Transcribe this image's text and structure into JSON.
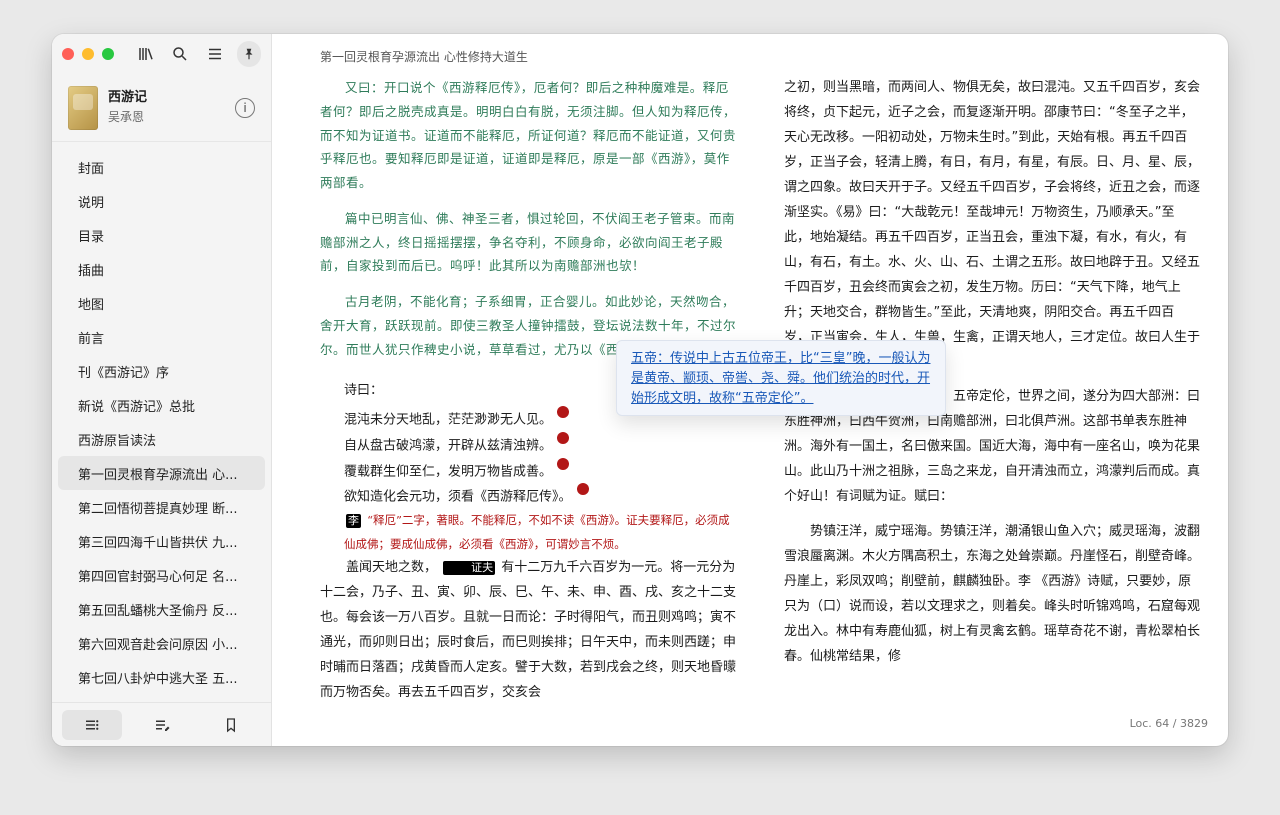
{
  "sidebar": {
    "toolbar": {
      "library_icon": "library-icon",
      "search_icon": "search-icon",
      "list_icon": "list-icon",
      "pin_icon": "pin-icon"
    },
    "book": {
      "title": "西游记",
      "author": "吴承恩",
      "info_icon": "info-icon"
    },
    "toc": [
      "封面",
      "说明",
      "目录",
      "插曲",
      "地图",
      "前言",
      "刊《西游记》序",
      "新说《西游记》总批",
      "西游原旨读法",
      "第一回灵根育孕源流出 心...",
      "第二回悟彻菩提真妙理 断...",
      "第三回四海千山皆拱伏 九...",
      "第四回官封弼马心何足 名...",
      "第五回乱蟠桃大圣偷丹 反...",
      "第六回观音赴会问原因 小...",
      "第七回八卦炉中逃大圣 五..."
    ],
    "active_index": 9,
    "footer": {
      "toc_icon": "toc-icon",
      "notes_icon": "notes-icon",
      "bookmark_icon": "bookmark-icon"
    }
  },
  "reader": {
    "running_head": "第一回灵根育孕源流出 心性修持大道生",
    "left": {
      "green_paragraphs": [
        "又曰：开口说个《西游释厄传》，厄者何？即后之种种魔难是。释厄者何？即后之脱壳成真是。明明白白有脱，无须注脚。但人知为释厄传，而不知为证道书。证道而不能释厄，所证何道？释厄而不能证道，又何贵乎释厄也。要知释厄即是证道，证道即是释厄，原是一部《西游》，莫作两部看。",
        "篇中已明言仙、佛、神圣三者，惧过轮回，不伏阎王老子管束。而南赡部洲之人，终日摇摇摆摆，争名夺利，不顾身命，必欲向阎王老子殿前，自家投到而后已。呜呼！此其所以为南赡部洲也欤！",
        "古月老阴，不能化育；子系细胃，正合婴儿。如此妙论，天然吻合，舍开大育，跃跃现前。即使三教圣人撞钟擂鼓，登坛说法数十年，不过尔尔。而世人犹只作稗史小说，草草看过，尤乃以《西游》为稗饰演义耶！"
      ],
      "poem_heading": "诗曰：",
      "poem_lines": [
        "混沌未分天地乱，茫茫渺渺无人见。",
        "自从盘古破鸿濛，开辟从兹清浊辨。",
        "覆载群生仰至仁，发明万物皆成善。",
        "欲知造化会元功，须看《西游释厄传》。"
      ],
      "poem_note_li": "李",
      "poem_note_zheng": "证夫",
      "poem_note_red": "“释厄”二字，著眼。不能释厄，不如不读《西游》。证夫要释厄，必须成仙成佛；要成仙成佛，必须看《西游》，可谓妙言不烦。",
      "body_start": "盖闻天地之数，",
      "body_rest": "有十二万九千六百岁为一元。将一元分为十二会，乃子、丑、寅、卯、辰、巳、午、未、申、酉、戌、亥之十二支也。每会该一万八百岁。且就一日而论：子时得阳气，而丑则鸡鸣；寅不通光，而卯则日出；辰时食后，而巳则挨排；日午天中，而未则西蹉；申时晡而日落酉；戌黄昏而人定亥。譬于大数，若到戌会之终，则天地昏曚而万物否矣。再去五千四百岁，交亥会"
    },
    "right": {
      "paragraph1": "之初，则当黑暗，而两间人、物俱无矣，故曰混沌。又五千四百岁，亥会将终，贞下起元，近子之会，而复逐渐开明。邵康节曰：“冬至子之半，天心无改移。一阳初动处，万物未生时。”到此，天始有根。再五千四百岁，正当子会，轻清上腾，有日，有月，有星，有辰。日、月、星、辰，谓之四象。故曰天开于子。又经五千四百岁，子会将终，近丑之会，而逐渐坚实。《易》曰：“大哉乾元！至哉坤元！万物资生，乃顺承天。”至此，地始凝结。再五千四百岁，正当丑会，重浊下凝，有水，有火，有山，有石，有土。水、火、山、石、土谓之五形。故曰地辟于丑。又经五千四百岁，丑会终而寅会之初，发生万物。历曰：“天气下降，地气上升；天地交合，群物皆生。”至此，天清地爽，阴阳交合。再五千四百岁，正当寅会，生人，生兽，生禽，正谓天地人，三才定位。故曰人生于寅。",
      "paragraph2": "感盘古开辟，三皇治世，五帝定伦，世界之间，遂分为四大部洲：曰东胜神洲，曰西牛贺洲，曰南赡部洲，曰北俱芦洲。这部书单表东胜神洲。海外有一国土，名曰傲来国。国近大海，海中有一座名山，唤为花果山。此山乃十洲之祖脉，三岛之来龙，自开清浊而立，鸿濛判后而成。真个好山！有词赋为证。赋曰：",
      "paragraph3": "势镇汪洋，威宁瑶海。势镇汪洋，潮涌银山鱼入穴；威灵瑶海，波翻雪浪蜃离渊。木火方隅高积土，东海之处耸崇巅。丹崖怪石，削壁奇峰。丹崖上，彩凤双鸣；削壁前，麒麟独卧。李 《西游》诗赋，只要妙，原只为（口）说而设，若以文理求之，则着矣。峰头时听锦鸡鸣，石窟每观龙出入。林中有寿鹿仙狐，树上有灵禽玄鹤。瑶草奇花不谢，青松翠柏长春。仙桃常结果，修"
    },
    "popover": "五帝：传说中上古五位帝王，比“三皇”晚，一般认为是黄帝、颛顼、帝喾、尧、舜。他们统治的时代，开始形成文明，故称“五帝定伦”。",
    "locator": "Loc. 64 / 3829"
  }
}
